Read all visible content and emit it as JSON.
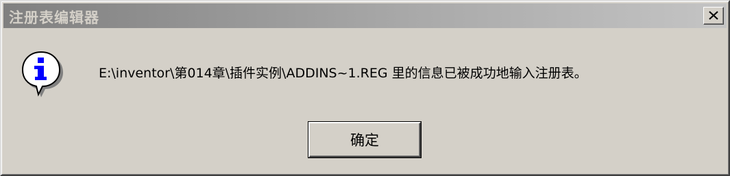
{
  "window": {
    "title": "注册表编辑器",
    "close_icon": "close-x-icon"
  },
  "message": {
    "icon": "information-icon",
    "text": "E:\\inventor\\第014章\\插件实例\\ADDINS~1.REG 里的信息已被成功地输入注册表。"
  },
  "buttons": {
    "ok_label": "确定"
  },
  "colors": {
    "face": "#d4d0c8",
    "title_gradient_start": "#808080",
    "title_gradient_end": "#c4c4c4",
    "title_text": "#d4d0c8",
    "icon_blue": "#0000ff"
  }
}
